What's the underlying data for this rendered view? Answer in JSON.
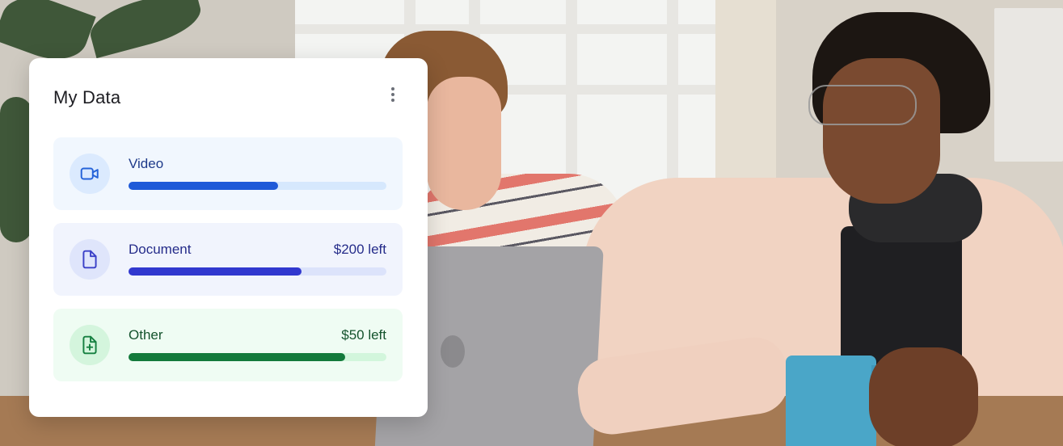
{
  "card": {
    "title": "My Data",
    "menu_icon": "more-vertical-icon",
    "items": [
      {
        "label": "Video",
        "left_text": "",
        "icon": "video-camera-icon",
        "progress": 0.58,
        "colors": {
          "bg": "#f1f7fe",
          "icon_bg": "#dbeafe",
          "icon": "#2563d9",
          "label": "#1e3a8a",
          "track": "#d6e8fd",
          "fill": "#1f5ad8"
        }
      },
      {
        "label": "Document",
        "left_text": "$200 left",
        "icon": "document-icon",
        "progress": 0.67,
        "colors": {
          "bg": "#f1f4fd",
          "icon_bg": "#dfe5fb",
          "icon": "#3b41c8",
          "label": "#252c8a",
          "track": "#dce3fb",
          "fill": "#3138cf"
        }
      },
      {
        "label": "Other",
        "left_text": "$50 left",
        "icon": "file-plus-icon",
        "progress": 0.84,
        "colors": {
          "bg": "#effcf3",
          "icon_bg": "#d4f5dd",
          "icon": "#168041",
          "label": "#14532d",
          "track": "#d2f6dc",
          "fill": "#137a3b"
        }
      }
    ]
  }
}
